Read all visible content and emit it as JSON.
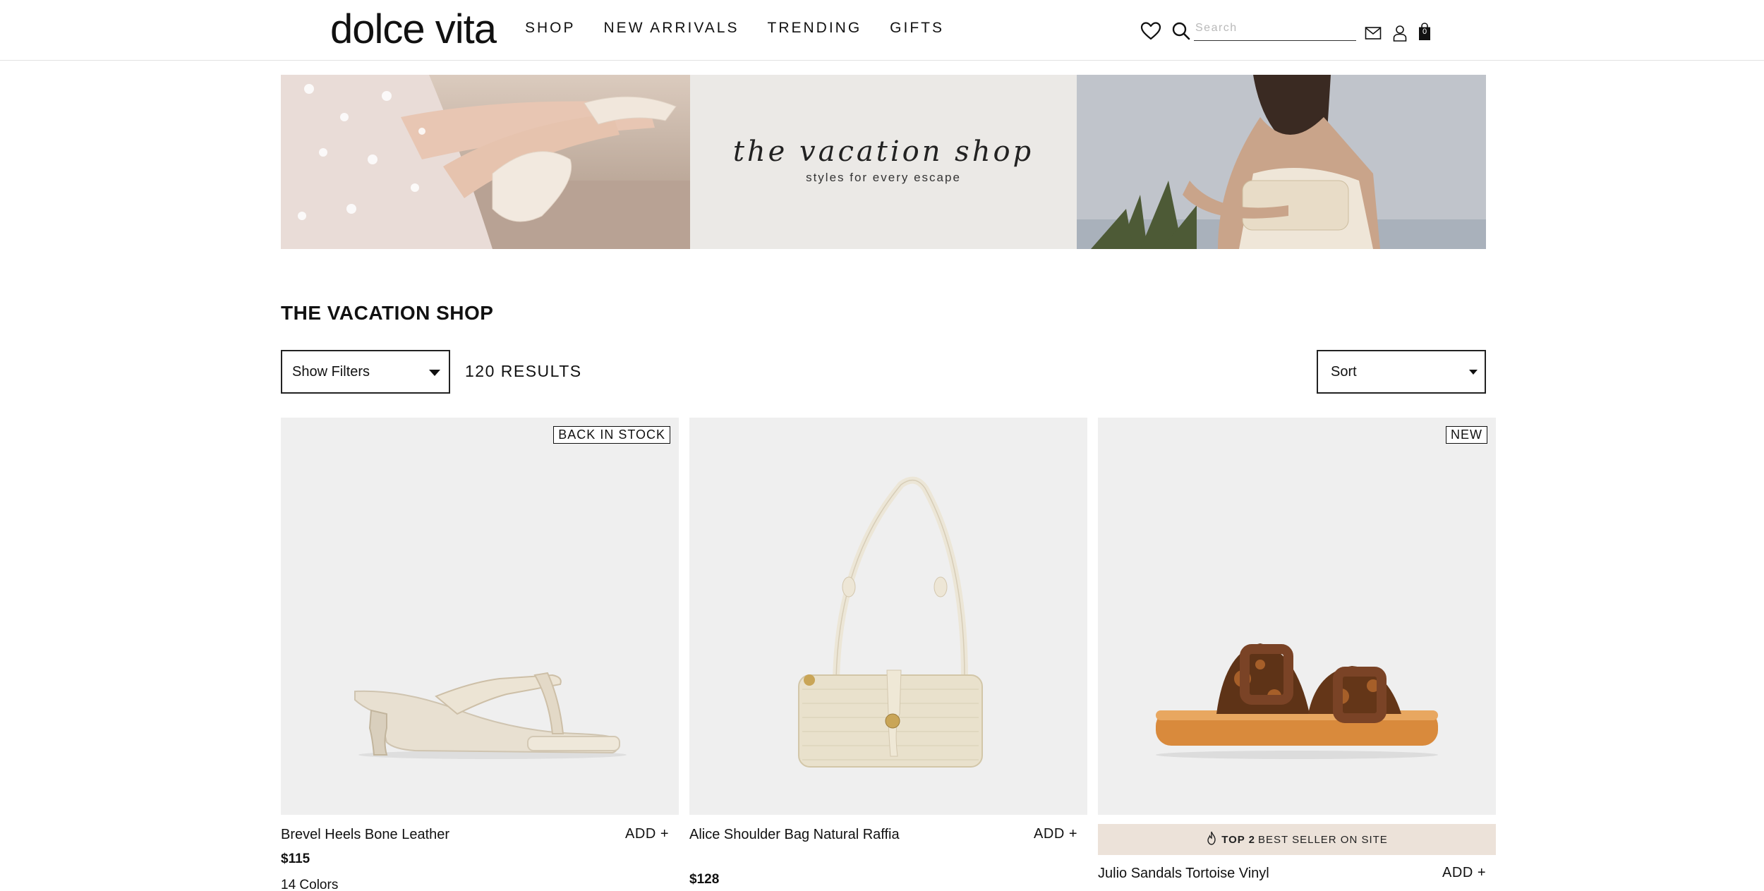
{
  "header": {
    "logo": "dolce vita",
    "nav": [
      "SHOP",
      "NEW ARRIVALS",
      "TRENDING",
      "GIFTS"
    ],
    "search_placeholder": "Search",
    "bag_count": "0"
  },
  "hero": {
    "title": "the vacation shop",
    "subtitle": "styles for every escape"
  },
  "page": {
    "title": "THE VACATION SHOP",
    "filters_label": "Show Filters",
    "results": "120 RESULTS",
    "sort_label": "Sort"
  },
  "products": [
    {
      "badge": "BACK IN STOCK",
      "name": "Brevel Heels Bone Leather",
      "add": "ADD +",
      "price": "$115",
      "colors": "14 Colors"
    },
    {
      "name": "Alice Shoulder Bag Natural Raffia",
      "add": "ADD +",
      "price": "$128"
    },
    {
      "badge": "NEW",
      "bestseller_strong": "TOP 2",
      "bestseller_rest": "BEST SELLER ON SITE",
      "name": "Julio Sandals Tortoise Vinyl",
      "add": "ADD +"
    }
  ],
  "colors": {
    "tile_bg": "#efefef",
    "bestseller_bg": "#ece2d9",
    "hero_mid_bg": "#ebe9e6"
  }
}
